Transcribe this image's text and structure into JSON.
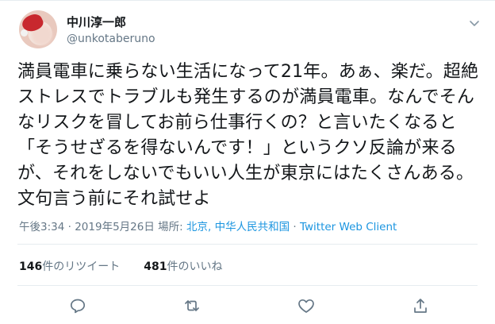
{
  "user": {
    "display_name": "中川淳一郎",
    "handle": "@unkotaberuno"
  },
  "tweet": {
    "text": "満員電車に乗らない生活になって21年。あぁ、楽だ。超絶ストレスでトラブルも発生するのが満員電車。なんでそんなリスクを冒してお前ら仕事行くの？と言いたくなると「そうせざるを得ないんです！」というクソ反論が来るが、それをしないでもいい人生が東京にはたくさんある。文句言う前にそれ試せよ"
  },
  "meta": {
    "time": "午後3:34",
    "separator": "·",
    "date": "2019年5月26日",
    "location_label": "場所: ",
    "location": "北京, 中华人民共和国",
    "client": "Twitter Web Client"
  },
  "stats": {
    "retweets_count": "146",
    "retweets_label": "件のリツイート",
    "likes_count": "481",
    "likes_label": "件のいいね"
  },
  "colors": {
    "text": "#14171a",
    "secondary": "#657786",
    "link": "#1b95e0",
    "border": "#e6ecf0"
  },
  "icons": [
    "chevron-down-icon",
    "reply-icon",
    "retweet-icon",
    "like-icon",
    "share-icon"
  ]
}
